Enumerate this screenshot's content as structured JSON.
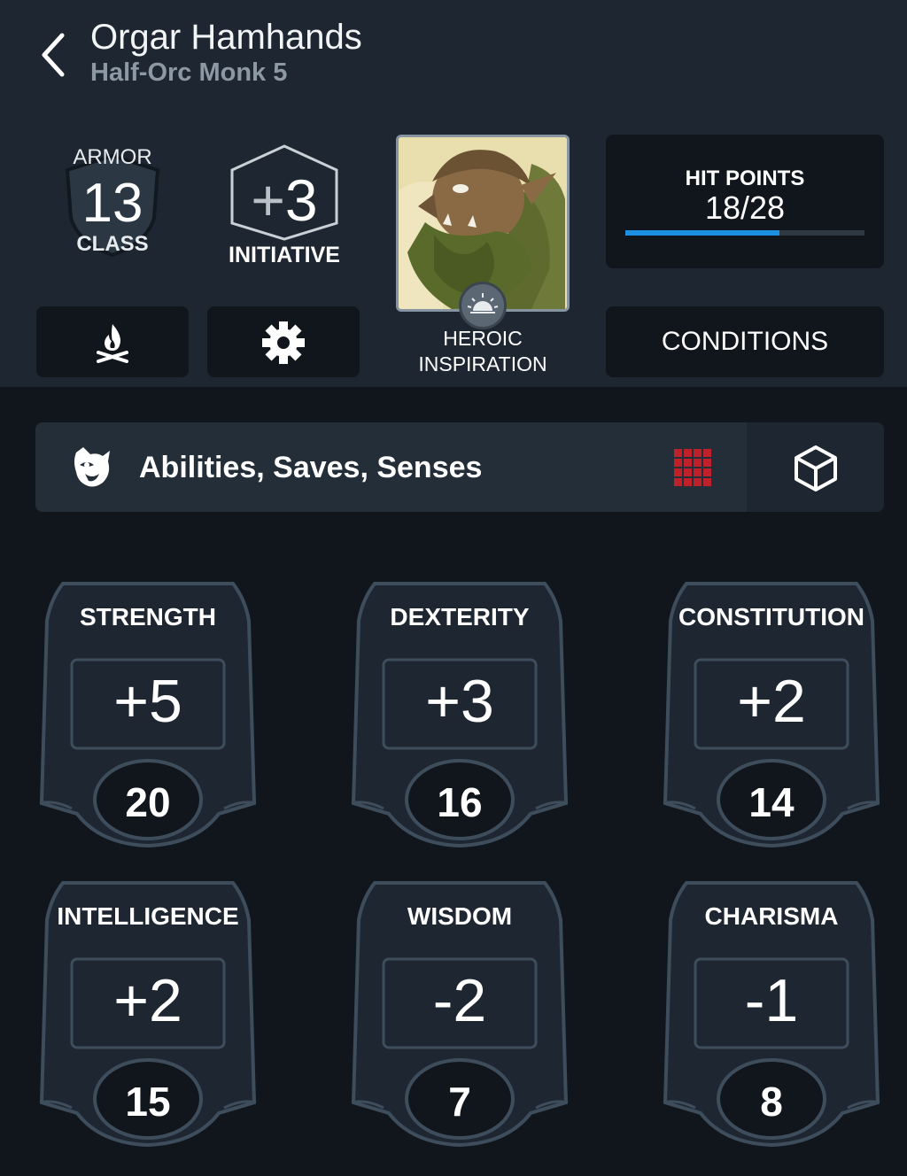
{
  "header": {
    "name": "Orgar Hamhands",
    "subtitle": "Half-Orc Monk 5"
  },
  "armor_class": {
    "label_top": "ARMOR",
    "value": "13",
    "label_bottom": "CLASS"
  },
  "initiative": {
    "sign": "+",
    "number": "3",
    "label": "INITIATIVE"
  },
  "inspiration": {
    "label_line1": "HEROIC",
    "label_line2": "INSPIRATION",
    "active": false
  },
  "hit_points": {
    "label": "HIT POINTS",
    "value": "18/28",
    "current": 18,
    "max": 28
  },
  "conditions": {
    "label": "CONDITIONS"
  },
  "section": {
    "title": "Abilities, Saves, Senses"
  },
  "abilities": [
    {
      "name": "STRENGTH",
      "modifier": "+5",
      "score": "20"
    },
    {
      "name": "DEXTERITY",
      "modifier": "+3",
      "score": "16"
    },
    {
      "name": "CONSTITUTION",
      "modifier": "+2",
      "score": "14"
    },
    {
      "name": "INTELLIGENCE",
      "modifier": "+2",
      "score": "15"
    },
    {
      "name": "WISDOM",
      "modifier": "-2",
      "score": "7"
    },
    {
      "name": "CHARISMA",
      "modifier": "-1",
      "score": "8"
    }
  ],
  "colors": {
    "accent_blue": "#1d8fe0",
    "grid_red": "#c0202a",
    "header_bg": "#1e2731",
    "page_bg": "#11161d"
  }
}
